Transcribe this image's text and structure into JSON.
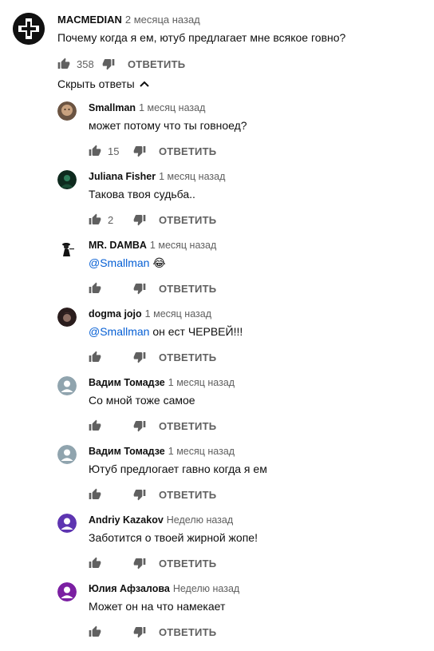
{
  "top_comment": {
    "author": "MACMEDIAN",
    "time": "2 месяца назад",
    "text": "Почему когда я ем, ютуб предлагает мне всякое говно?",
    "likes": "358",
    "reply_label": "ОТВЕТИТЬ"
  },
  "hide_replies_label": "Скрыть ответы",
  "replies": [
    {
      "author": "Smallman",
      "time": "1 месяц назад",
      "mention": "",
      "text": "может потому что ты говноед?",
      "likes": "15",
      "reply_label": "ОТВЕТИТЬ",
      "avatar_color": "#8a6a52"
    },
    {
      "author": "Juliana Fisher",
      "time": "1 месяц назад",
      "mention": "",
      "text": "Такова твоя судьба..",
      "likes": "2",
      "reply_label": "ОТВЕТИТЬ",
      "avatar_color": "#0e2a1e"
    },
    {
      "author": "MR. DAMBA",
      "time": "1 месяц назад",
      "mention": "@Smallman",
      "text": " 😂",
      "likes": "",
      "reply_label": "ОТВЕТИТЬ",
      "avatar_color": "#ffffff"
    },
    {
      "author": "dogma jojo",
      "time": "1 месяц назад",
      "mention": "@Smallman",
      "text": " он ест ЧЕРВЕЙ!!!",
      "likes": "",
      "reply_label": "ОТВЕТИТЬ",
      "avatar_color": "#2a1d1d"
    },
    {
      "author": "Вадим Томадзе",
      "time": "1 месяц назад",
      "mention": "",
      "text": "Со мной тоже самое",
      "likes": "",
      "reply_label": "ОТВЕТИТЬ",
      "avatar_color": "#90a4ae"
    },
    {
      "author": "Вадим Томадзе",
      "time": "1 месяц назад",
      "mention": "",
      "text": "Ютуб предлогает гавно когда я ем",
      "likes": "",
      "reply_label": "ОТВЕТИТЬ",
      "avatar_color": "#90a4ae"
    },
    {
      "author": "Andriy Kazakov",
      "time": "Неделю назад",
      "mention": "",
      "text": "Заботится о твоей жирной жопе!",
      "likes": "",
      "reply_label": "ОТВЕТИТЬ",
      "avatar_color": "#5e35b1"
    },
    {
      "author": "Юлия Афзалова",
      "time": "Неделю назад",
      "mention": "",
      "text": "Может он на  что намекает",
      "likes": "",
      "reply_label": "ОТВЕТИТЬ",
      "avatar_color": "#7b1fa2"
    }
  ],
  "icons": {
    "like": "thumb-up-icon",
    "dislike": "thumb-down-icon",
    "chevron": "chevron-up-icon"
  }
}
